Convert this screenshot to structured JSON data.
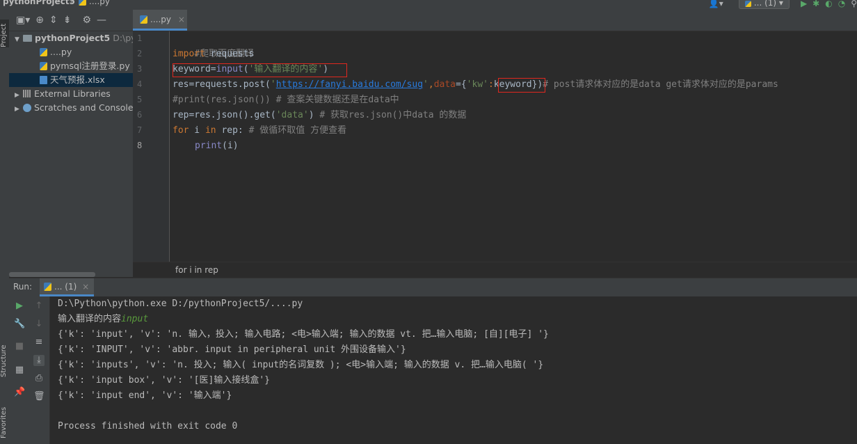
{
  "window": {
    "project_crumb": "pythonProject5",
    "file_crumb": "....py",
    "run_config": "... (1)"
  },
  "left_strip": {
    "project": "Project",
    "structure": "Structure",
    "favorites": "Favorites"
  },
  "project_tree": {
    "root_name": "pythonProject5",
    "root_path": "D:\\pyt",
    "files": [
      "....py",
      "pymsql注册登录.py",
      "天气预报.xlsx"
    ],
    "external_libraries": "External Libraries",
    "scratches": "Scratches and Consoles"
  },
  "editor": {
    "tab_label": "....py",
    "line_numbers": [
      "1",
      "2",
      "3",
      "4",
      "5",
      "6",
      "7",
      "8"
    ],
    "breadcrumb": "for i in rep",
    "code": {
      "l1_comment": "#爬取百度翻译",
      "l2_kw": "import",
      "l2_rest": " requests",
      "l3_a": "keyword=",
      "l3_fn": "input",
      "l3_b": "(",
      "l3_str": "'输入翻译的内容'",
      "l3_c": ")",
      "l4_a": "res=requests.post(",
      "l4_q1": "'",
      "l4_url": "https://fanyi.baidu.com/sug",
      "l4_q2": "'",
      "l4_comma": ",",
      "l4_param": "data",
      "l4_b": "={",
      "l4_key": "'kw'",
      "l4_colon": ":",
      "l4_var": "keyword",
      "l4_c": "})",
      "l4_comment": "# post请求体对应的是data get请求体对应的是params",
      "l5_comment": "#print(res.json()) # 查案关键数据还是在data中",
      "l6_a": "rep=res.json().get(",
      "l6_str": "'data'",
      "l6_b": ") ",
      "l6_comment": "# 获取res.json()中data 的数据",
      "l7_kw1": "for",
      "l7_a": " i ",
      "l7_kw2": "in",
      "l7_b": " rep: ",
      "l7_comment": "# 做循环取值 方便查看",
      "l8_fn": "print",
      "l8_a": "(i)"
    }
  },
  "run": {
    "label": "Run:",
    "tab": "... (1)",
    "console": {
      "cmd": "D:\\Python\\python.exe D:/pythonProject5/....py",
      "prompt": "输入翻译的内容",
      "input": "input",
      "out1": "{'k': 'input', 'v': 'n. 输入，投入; 输入电路; <电>输入端; 输入的数据 vt. 把…输入电脑; [自][电子] '}",
      "out2": "{'k': 'INPUT', 'v': 'abbr. input in peripheral unit 外围设备输入'}",
      "out3": "{'k': 'inputs', 'v': 'n. 投入; 输入( input的名词复数 ); <电>输入端; 输入的数据 v. 把…输入电脑( '}",
      "out4": "{'k': 'input box', 'v': '[医]输入接线盒'}",
      "out5": "{'k': 'input end', 'v': '输入端'}",
      "exit": "Process finished with exit code 0"
    }
  }
}
